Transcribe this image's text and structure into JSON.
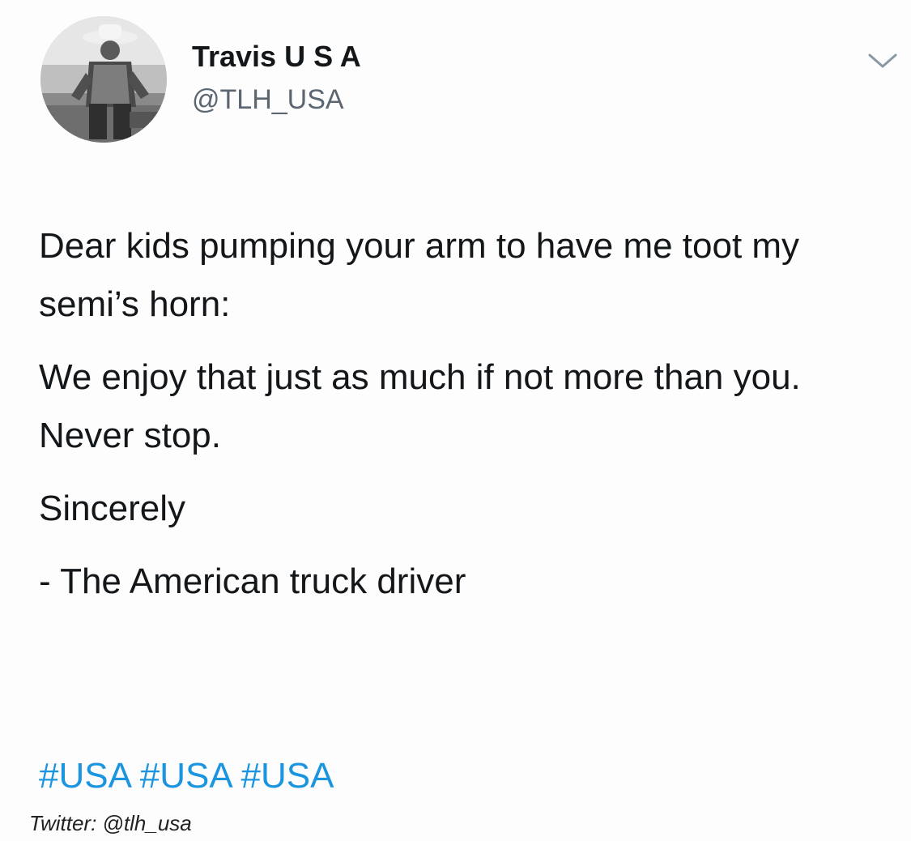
{
  "author": {
    "display_name": "Travis U S A",
    "handle": "@TLH_USA"
  },
  "tweet": {
    "paragraphs": [
      "Dear kids pumping your arm to have me toot my semi’s horn:",
      "We enjoy that just as much if not more than you. Never stop.",
      "Sincerely",
      "- The American truck driver"
    ],
    "hashtags": [
      "#USA",
      "#USA",
      "#USA"
    ]
  },
  "caption": "Twitter: @tlh_usa",
  "icons": {
    "menu": "chevron-down-icon"
  },
  "colors": {
    "text": "#14171a",
    "handle": "#5b6670",
    "hashtag": "#1b95e0"
  }
}
